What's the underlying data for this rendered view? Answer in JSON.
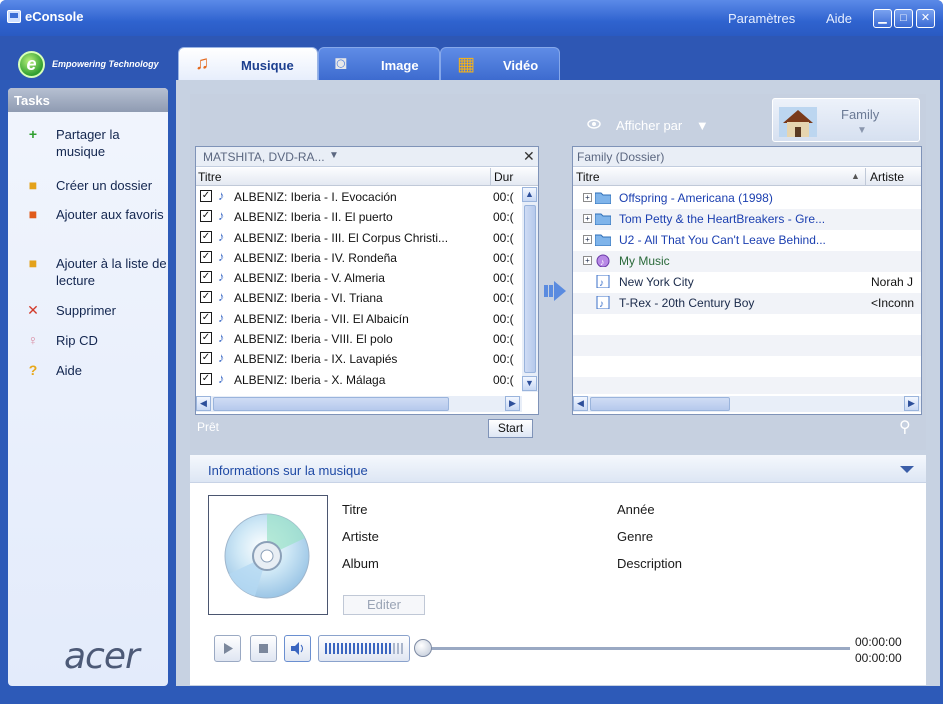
{
  "app": {
    "title": "eConsole",
    "settings": "Paramètres",
    "help": "Aide"
  },
  "brand": {
    "tagline": "Empowering Technology",
    "logo_letter": "e",
    "bottom_logo": "acer"
  },
  "tabs": [
    {
      "label": "Musique",
      "active": true
    },
    {
      "label": "Image",
      "active": false
    },
    {
      "label": "Vidéo",
      "active": false
    }
  ],
  "sidebar": {
    "header": "Tasks",
    "items": [
      {
        "label": "Partager la musique",
        "icon": "plus-icon",
        "color": "#2e9e2e"
      },
      {
        "label": "Créer un dossier",
        "icon": "new-folder-icon",
        "color": "#e4a21a"
      },
      {
        "label": "Ajouter aux favoris",
        "icon": "favorite-folder-icon",
        "color": "#e05a1a"
      },
      {
        "label": "Ajouter à la liste de lecture",
        "icon": "playlist-folder-icon",
        "color": "#e4a21a"
      },
      {
        "label": "Supprimer",
        "icon": "delete-x-icon",
        "color": "#d23a2a"
      },
      {
        "label": "Rip CD",
        "icon": "rip-cd-icon",
        "color": "#d88aa0"
      },
      {
        "label": "Aide",
        "icon": "help-question-icon",
        "color": "#e8a81a"
      }
    ]
  },
  "view": {
    "afficher_par": "Afficher par",
    "family_label": "Family"
  },
  "source_panel": {
    "device": "MATSHITA, DVD-RA...",
    "col_title": "Titre",
    "col_duration": "Dur",
    "tracks": [
      {
        "title": "ALBENIZ: Iberia - I. Evocación",
        "duration": "00:("
      },
      {
        "title": "ALBENIZ: Iberia - II. El puerto",
        "duration": "00:("
      },
      {
        "title": "ALBENIZ: Iberia - III. El Corpus Christi...",
        "duration": "00:("
      },
      {
        "title": "ALBENIZ: Iberia - IV. Rondeña",
        "duration": "00:("
      },
      {
        "title": "ALBENIZ: Iberia - V. Almeria",
        "duration": "00:("
      },
      {
        "title": "ALBENIZ: Iberia - VI. Triana",
        "duration": "00:("
      },
      {
        "title": "ALBENIZ: Iberia - VII. El Albaicín",
        "duration": "00:("
      },
      {
        "title": "ALBENIZ: Iberia - VIII. El polo",
        "duration": "00:("
      },
      {
        "title": "ALBENIZ: Iberia - IX. Lavapiés",
        "duration": "00:("
      },
      {
        "title": "ALBENIZ: Iberia - X. Málaga",
        "duration": "00:("
      }
    ],
    "status": "Prêt",
    "start": "Start"
  },
  "library_panel": {
    "header": "Family (Dossier)",
    "col_title": "Titre",
    "col_artist": "Artiste",
    "items": [
      {
        "name": "Offspring - Americana (1998)",
        "artist": "",
        "type": "folder"
      },
      {
        "name": "Tom Petty & the HeartBreakers - Gre...",
        "artist": "",
        "type": "folder"
      },
      {
        "name": "U2 - All That You Can't Leave Behind...",
        "artist": "",
        "type": "folder"
      },
      {
        "name": "My Music",
        "artist": "",
        "type": "mymusic"
      },
      {
        "name": "New York City",
        "artist": "Norah J",
        "type": "file"
      },
      {
        "name": "T-Rex - 20th Century Boy",
        "artist": "<Inconn",
        "type": "file"
      }
    ]
  },
  "info": {
    "title": "Informations sur la musique",
    "fields_left": [
      "Titre",
      "Artiste",
      "Album"
    ],
    "fields_right": [
      "Année",
      "Genre",
      "Description"
    ],
    "edit": "Editer",
    "time_elapsed": "00:00:00",
    "time_total": "00:00:00",
    "volume_level": 0.85,
    "seek_position": 0
  }
}
